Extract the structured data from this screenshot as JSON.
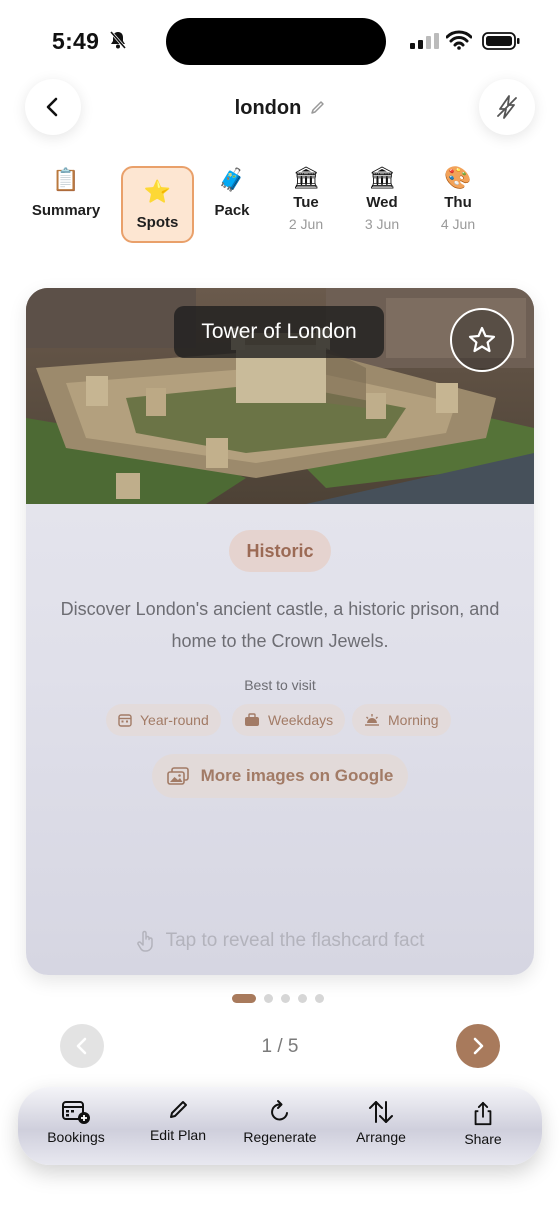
{
  "status": {
    "time": "5:49"
  },
  "header": {
    "title": "london",
    "back_icon": "chevron-left-icon",
    "flash_icon": "flash-off-icon"
  },
  "tabs": [
    {
      "label": "Summary",
      "emoji": "📋",
      "sub": ""
    },
    {
      "label": "Spots",
      "emoji": "⭐",
      "sub": "",
      "selected": true
    },
    {
      "label": "Pack",
      "emoji": "🧳",
      "sub": ""
    },
    {
      "label": "Tue",
      "emoji": "🏛",
      "sub": "2 Jun"
    },
    {
      "label": "Wed",
      "emoji": "🏛",
      "sub": "3 Jun"
    },
    {
      "label": "Thu",
      "emoji": "🎨",
      "sub": "4 Jun"
    }
  ],
  "card": {
    "title": "Tower of London",
    "category": "Historic",
    "description": "Discover London's ancient castle, a historic prison, and home to the Crown Jewels.",
    "best_label": "Best to visit",
    "chips": [
      "Year-round",
      "Weekdays",
      "Morning"
    ],
    "google_label": "More images on Google",
    "tap_hint": "Tap to reveal the flashcard fact"
  },
  "pager": {
    "counter": "1 / 5",
    "current": 1,
    "total": 5
  },
  "toolbar": {
    "items": [
      "Bookings",
      "Edit Plan",
      "Regenerate",
      "Arrange",
      "Share"
    ]
  },
  "colors": {
    "accent": "#a87a5c",
    "spots_bg": "#fde6d2",
    "spots_border": "#e9a06a"
  }
}
